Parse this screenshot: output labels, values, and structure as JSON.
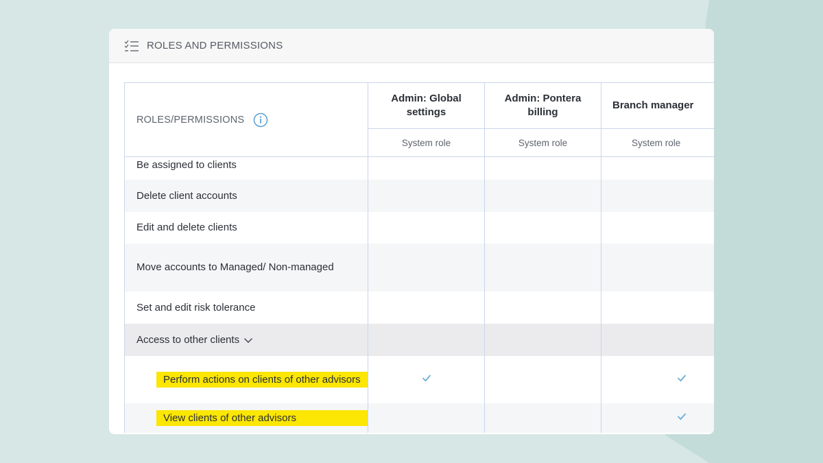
{
  "header": {
    "title": "ROLES AND PERMISSIONS",
    "icon": "checklist-icon"
  },
  "table": {
    "corner_label": "ROLES/PERMISSIONS",
    "corner_icon": "info-icon",
    "roles": [
      {
        "name": "Admin: Global settings",
        "type": "System role"
      },
      {
        "name": "Admin: Pontera billing",
        "type": "System role"
      },
      {
        "name": "Branch manager",
        "type": "System role"
      }
    ],
    "rows": [
      {
        "label": "Be assigned to clients",
        "values": [
          false,
          false,
          false
        ]
      },
      {
        "label": "Delete client accounts",
        "values": [
          false,
          false,
          false
        ]
      },
      {
        "label": "Edit and delete clients",
        "values": [
          false,
          false,
          false
        ]
      },
      {
        "label": "Move accounts to Managed/ Non-managed",
        "values": [
          false,
          false,
          false
        ]
      },
      {
        "label": "Set and edit risk tolerance",
        "values": [
          false,
          false,
          false
        ]
      },
      {
        "label": "Access to other clients",
        "values": [
          false,
          false,
          false
        ]
      },
      {
        "label": "Perform actions on clients of other advisors",
        "values": [
          true,
          false,
          true
        ]
      },
      {
        "label": "View clients of other advisors",
        "values": [
          false,
          false,
          true
        ]
      }
    ]
  },
  "colors": {
    "highlight": "#fbe604",
    "check": "#6aaed6",
    "grid": "#c9d6e8"
  }
}
